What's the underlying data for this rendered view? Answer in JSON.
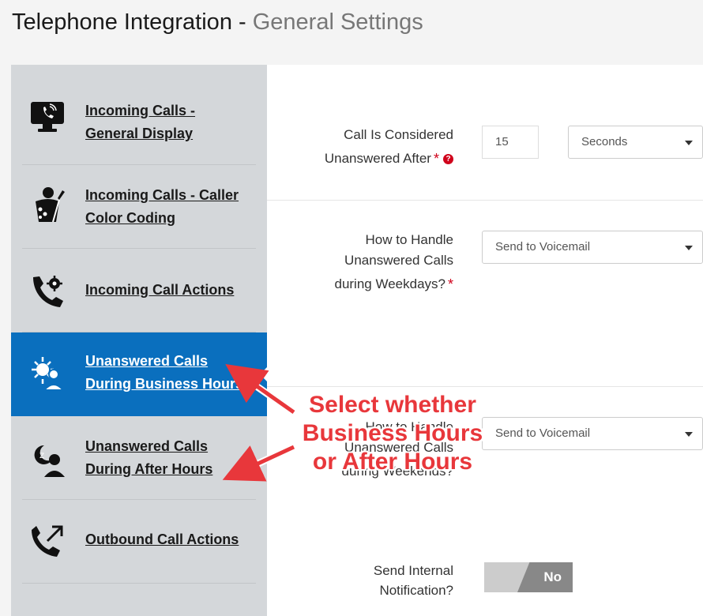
{
  "header": {
    "title": "Telephone Integration",
    "separator": " - ",
    "subtitle": "General Settings"
  },
  "sidebar": {
    "items": [
      {
        "label": "Incoming Calls -\nGeneral Display",
        "icon": "monitor-phone-icon",
        "active": false
      },
      {
        "label": "Incoming Calls - Caller\nColor Coding",
        "icon": "paint-person-icon",
        "active": false
      },
      {
        "label": "Incoming Call Actions",
        "icon": "phone-gear-icon",
        "active": false
      },
      {
        "label": "Unanswered Calls\nDuring Business Hours",
        "icon": "sun-user-icon",
        "active": true
      },
      {
        "label": "Unanswered Calls\nDuring After Hours",
        "icon": "moon-user-icon",
        "active": false
      },
      {
        "label": "Outbound Call Actions",
        "icon": "phone-outgoing-icon",
        "active": false
      }
    ]
  },
  "form": {
    "unanswered_after": {
      "label_line1": "Call Is Considered",
      "label_line2": "Unanswered After",
      "value": "15",
      "unit": "Seconds"
    },
    "weekdays": {
      "label_line1": "How to Handle",
      "label_line2": "Unanswered Calls",
      "label_line3": "during Weekdays?",
      "value": "Send to Voicemail"
    },
    "weekends": {
      "label_line1": "How to Handle",
      "label_line2": "Unanswered Calls",
      "label_line3": "during Weekends?",
      "value": "Send to Voicemail"
    },
    "notification": {
      "label_line1": "Send Internal",
      "label_line2": "Notification?",
      "value": "No"
    },
    "required_mark": "*",
    "help_mark": "?"
  },
  "annotation": {
    "line1": "Select whether",
    "line2": "Business Hours",
    "line3": "or After Hours",
    "color": "#e8373b"
  },
  "colors": {
    "active_nav": "#0a6fbe",
    "sidebar_bg": "#d4d7da",
    "required": "#d0021b"
  }
}
